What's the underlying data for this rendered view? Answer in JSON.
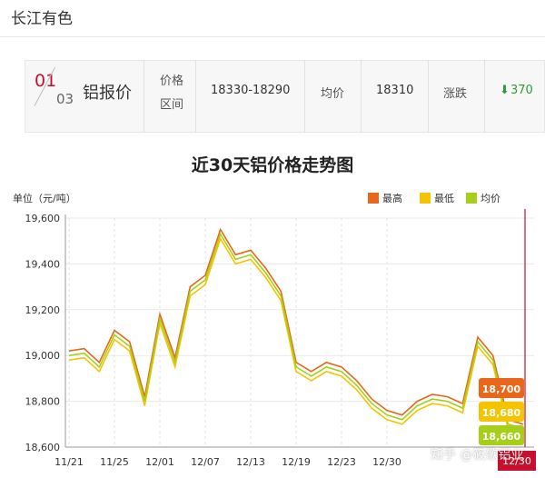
{
  "header": {
    "brand": "长江有色"
  },
  "quote": {
    "index_current": "01",
    "index_total": "03",
    "product": "铝报价",
    "range_label": "价格区间",
    "range_value": "18330-18290",
    "avg_label": "均价",
    "avg_value": "18310",
    "change_label": "涨跌",
    "change_arrow": "⬇",
    "change_value": "370"
  },
  "chart_data": {
    "type": "line",
    "title": "近30天铝价格走势图",
    "ylabel": "单位（元/吨）",
    "ylim": [
      18600,
      19600
    ],
    "yticks": [
      "19,600",
      "19,400",
      "19,200",
      "19,000",
      "18,800",
      "18,600"
    ],
    "x_tick_labels": [
      "11/21",
      "11/25",
      "12/01",
      "12/07",
      "12/13",
      "12/19",
      "12/23",
      "12/30"
    ],
    "x_tick_positions": [
      0,
      3,
      6,
      9,
      12,
      15,
      18,
      21
    ],
    "series": [
      {
        "name": "最高",
        "color": "#e8671b",
        "values": [
          19020,
          19030,
          18970,
          19110,
          19060,
          18820,
          19180,
          18990,
          19300,
          19350,
          19550,
          19440,
          19460,
          19380,
          19280,
          18970,
          18930,
          18970,
          18950,
          18890,
          18810,
          18760,
          18740,
          18800,
          18830,
          18820,
          18790,
          19080,
          19000,
          18720,
          18700
        ]
      },
      {
        "name": "最低",
        "color": "#f5c400",
        "values": [
          18980,
          18990,
          18930,
          19070,
          19020,
          18780,
          19140,
          18950,
          19260,
          19310,
          19510,
          19400,
          19420,
          19340,
          19240,
          18930,
          18890,
          18930,
          18910,
          18850,
          18770,
          18720,
          18700,
          18760,
          18790,
          18780,
          18750,
          19040,
          18960,
          18680,
          18660
        ]
      },
      {
        "name": "均价",
        "color": "#a6cf1a",
        "values": [
          19000,
          19010,
          18950,
          19090,
          19040,
          18800,
          19160,
          18970,
          19280,
          19330,
          19530,
          19420,
          19440,
          19360,
          19260,
          18950,
          18910,
          18950,
          18930,
          18870,
          18790,
          18740,
          18720,
          18780,
          18810,
          18800,
          18770,
          19060,
          18980,
          18700,
          18680
        ]
      }
    ],
    "end_labels": [
      "18,700",
      "18,680",
      "18,660"
    ],
    "grid": true,
    "legend": "top-right",
    "cursor_label": "12/30",
    "cursor_color": "#c8102e"
  },
  "watermark": "知乎 @筱歌铝业"
}
